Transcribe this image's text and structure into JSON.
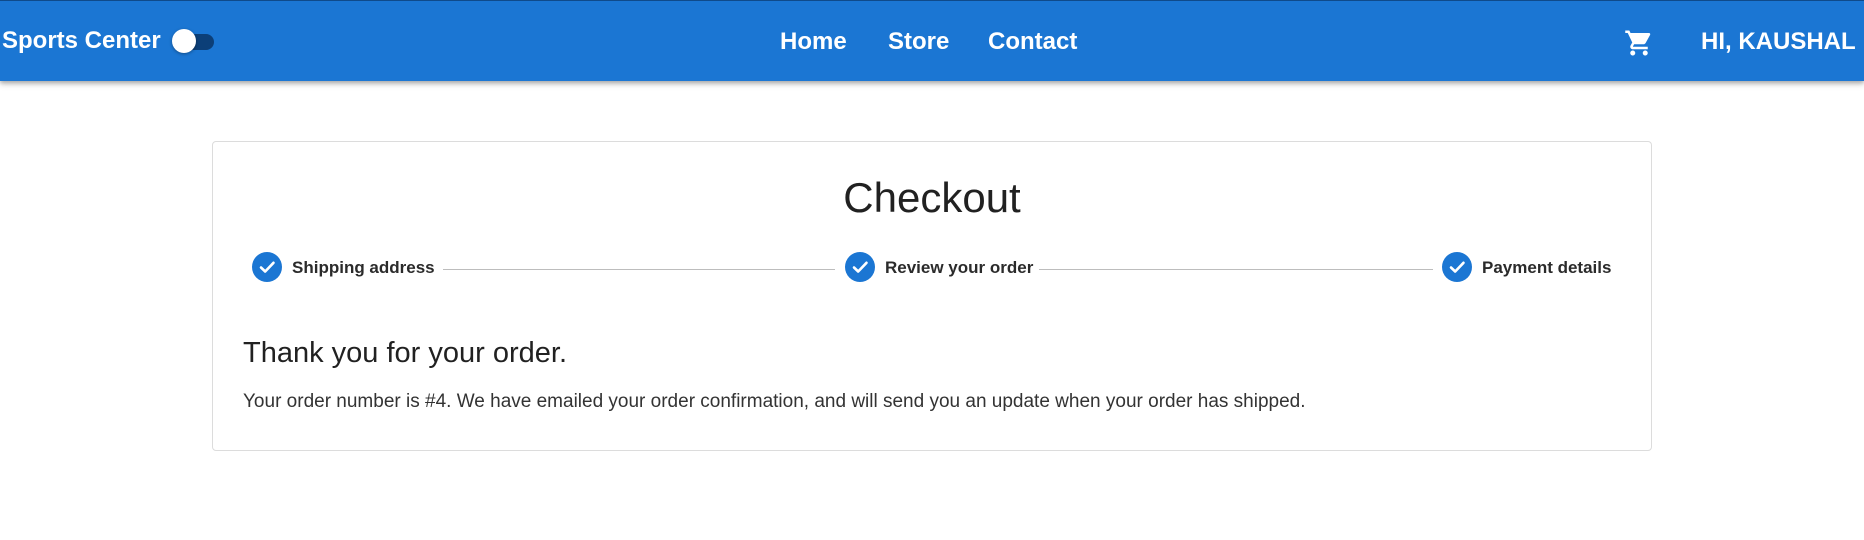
{
  "header": {
    "brand": "Sports Center",
    "theme_toggle": {
      "on": false
    },
    "nav": [
      {
        "label": "Home"
      },
      {
        "label": "Store"
      },
      {
        "label": "Contact"
      }
    ],
    "cart_icon": "shopping-cart-icon",
    "user_greeting": "HI, KAUSHAL"
  },
  "checkout": {
    "title": "Checkout",
    "steps": [
      {
        "label": "Shipping address",
        "completed": true,
        "icon": "check-icon"
      },
      {
        "label": "Review your order",
        "completed": true,
        "icon": "check-icon"
      },
      {
        "label": "Payment details",
        "completed": true,
        "icon": "check-icon"
      }
    ],
    "confirmation_heading": "Thank you for your order.",
    "confirmation_message": "Your order number is #4. We have emailed your order confirmation, and will send you an update when your order has shipped."
  },
  "colors": {
    "primary": "#1b76d3",
    "toggle_track": "#0c3f78"
  }
}
